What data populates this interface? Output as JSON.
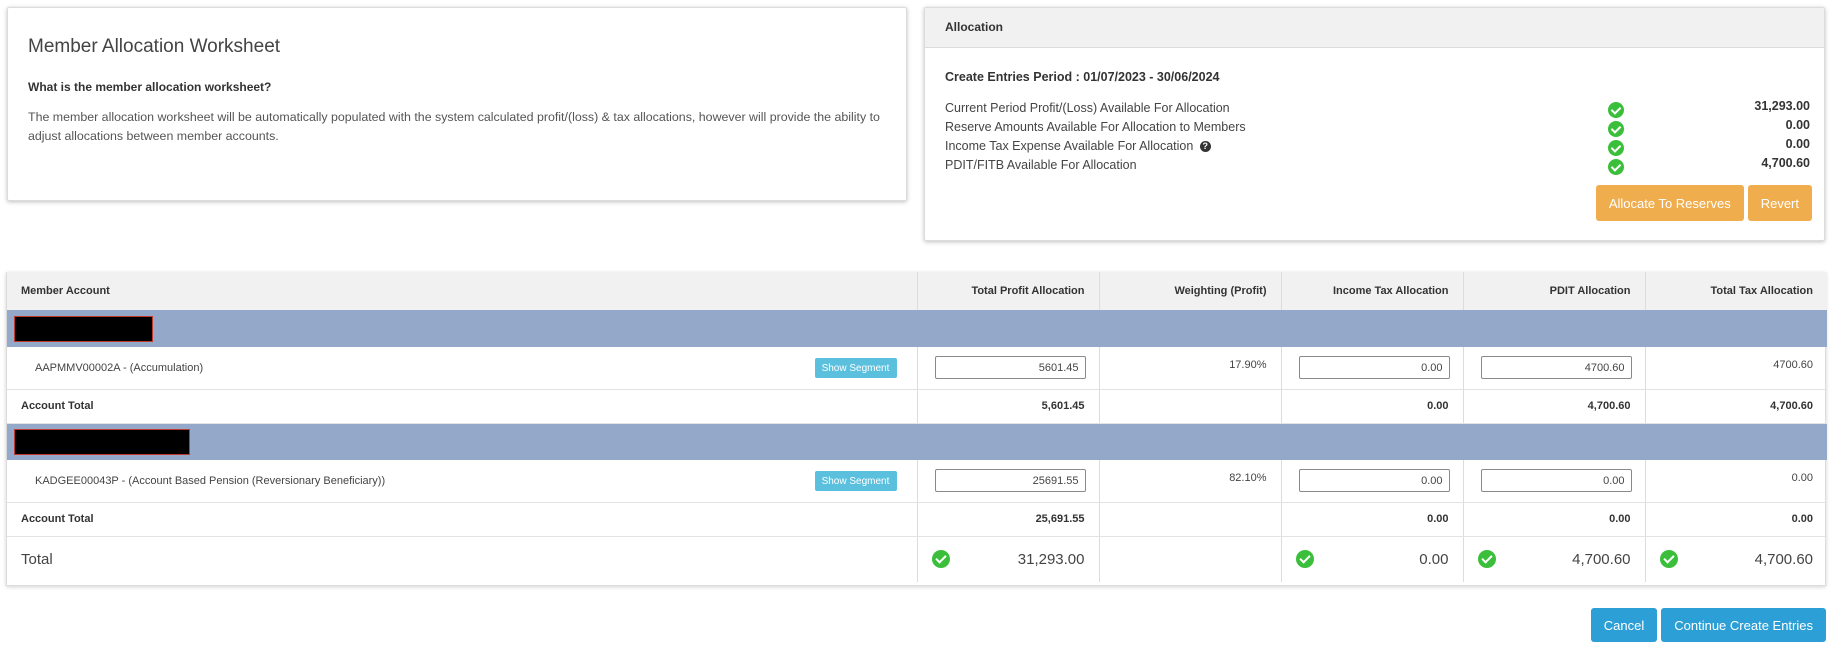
{
  "info": {
    "title": "Member Allocation Worksheet",
    "subtitle": "What is the member allocation worksheet?",
    "text": "The member allocation worksheet will be automatically populated with the system calculated profit/(loss) & tax allocations, however will provide the ability to adjust allocations between member accounts."
  },
  "allocation": {
    "header": "Allocation",
    "period": "Create Entries Period : 01/07/2023 - 30/06/2024",
    "rows": [
      {
        "label": "Current Period Profit/(Loss) Available For Allocation",
        "value": "31,293.00"
      },
      {
        "label": "Reserve Amounts Available For Allocation to Members",
        "value": "0.00"
      },
      {
        "label": "Income Tax Expense Available For Allocation",
        "value": "0.00"
      },
      {
        "label": "PDIT/FITB Available For Allocation",
        "value": "4,700.60"
      }
    ],
    "help_symbol": "?",
    "allocate_button": "Allocate To Reserves",
    "revert_button": "Revert"
  },
  "table": {
    "columns": [
      "Member Account",
      "Total Profit Allocation",
      "Weighting (Profit)",
      "Income Tax Allocation",
      "PDIT Allocation",
      "Total Tax Allocation"
    ],
    "segment_button": "Show Segment",
    "groups": [
      {
        "member": {
          "name": "AAPMMV00002A - (Accumulation)",
          "profit": "5601.45",
          "weighting": "17.90%",
          "income_tax": "0.00",
          "pdit": "4700.60",
          "total_tax": "4700.60"
        },
        "total": {
          "label": "Account Total",
          "profit": "5,601.45",
          "income_tax": "0.00",
          "pdit": "4,700.60",
          "total_tax": "4,700.60"
        }
      },
      {
        "member": {
          "name": "KADGEE00043P - (Account Based Pension (Reversionary Beneficiary))",
          "profit": "25691.55",
          "weighting": "82.10%",
          "income_tax": "0.00",
          "pdit": "0.00",
          "total_tax": "0.00"
        },
        "total": {
          "label": "Account Total",
          "profit": "25,691.55",
          "income_tax": "0.00",
          "pdit": "0.00",
          "total_tax": "0.00"
        }
      }
    ],
    "grand_total": {
      "label": "Total",
      "profit": "31,293.00",
      "income_tax": "0.00",
      "pdit": "4,700.60",
      "total_tax": "4,700.60"
    }
  },
  "footer": {
    "cancel_button": "Cancel",
    "continue_button": "Continue Create Entries"
  },
  "colors": {
    "accent_orange": "#f0ad4e",
    "accent_blue": "#2c9fd6",
    "segment_blue": "#5bc0de",
    "group_row": "#94a8c9",
    "check_green": "#3bbf3b"
  }
}
